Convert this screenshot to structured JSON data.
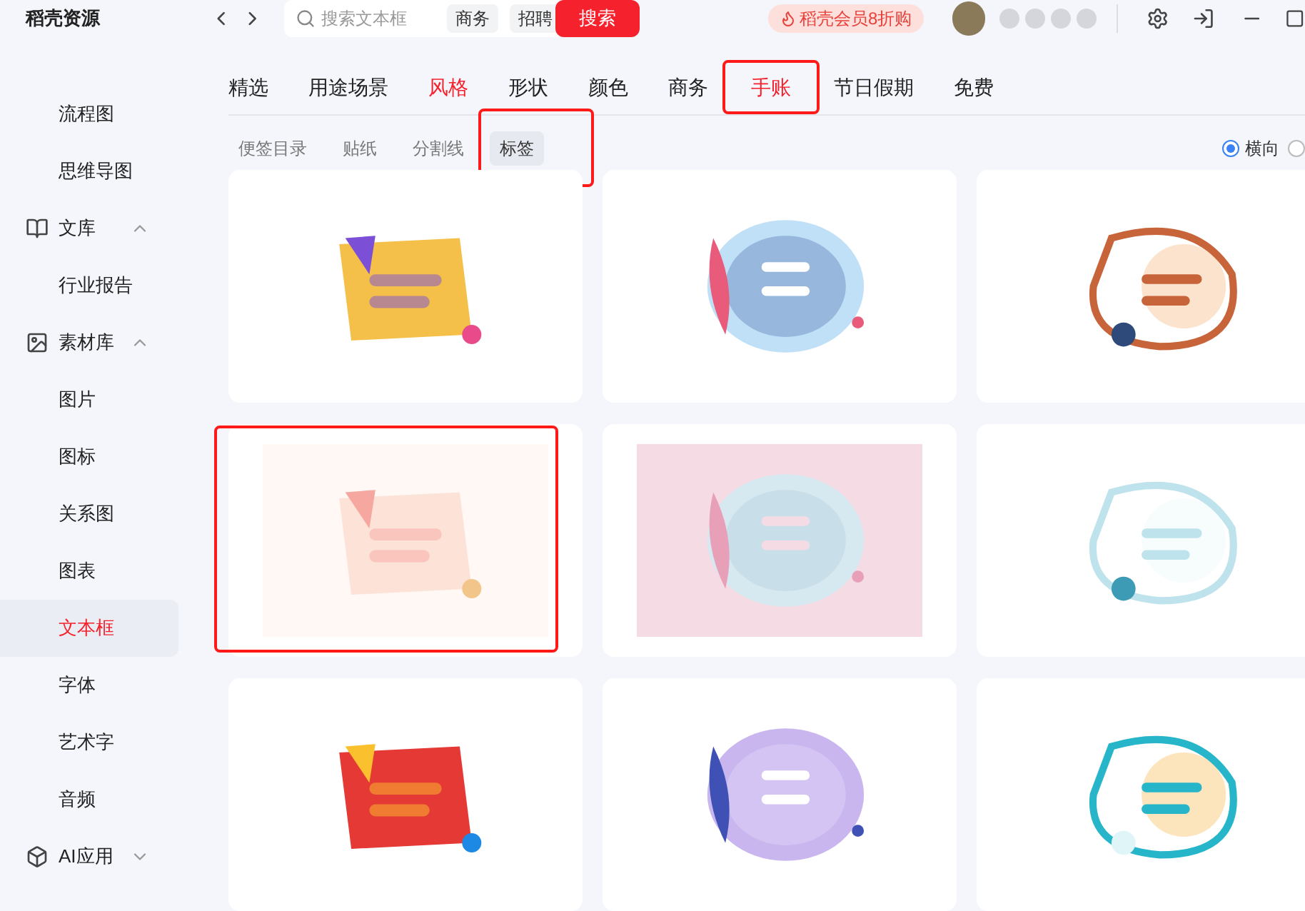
{
  "app": {
    "title": "稻壳资源"
  },
  "search": {
    "placeholder": "搜索文本框",
    "tags": [
      "商务",
      "招聘"
    ],
    "button": "搜索"
  },
  "promo": {
    "label": "稻壳会员8折购"
  },
  "sidebar": {
    "items": [
      {
        "kind": "item",
        "label": "流程图",
        "selected": false
      },
      {
        "kind": "item",
        "label": "思维导图",
        "selected": false
      },
      {
        "kind": "group",
        "label": "文库",
        "expanded": true
      },
      {
        "kind": "item",
        "label": "行业报告",
        "selected": false
      },
      {
        "kind": "group",
        "label": "素材库",
        "expanded": true
      },
      {
        "kind": "item",
        "label": "图片",
        "selected": false
      },
      {
        "kind": "item",
        "label": "图标",
        "selected": false
      },
      {
        "kind": "item",
        "label": "关系图",
        "selected": false
      },
      {
        "kind": "item",
        "label": "图表",
        "selected": false
      },
      {
        "kind": "item",
        "label": "文本框",
        "selected": true
      },
      {
        "kind": "item",
        "label": "字体",
        "selected": false
      },
      {
        "kind": "item",
        "label": "艺术字",
        "selected": false
      },
      {
        "kind": "item",
        "label": "音频",
        "selected": false
      },
      {
        "kind": "group",
        "label": "AI应用",
        "expanded": false
      }
    ]
  },
  "categories": [
    {
      "label": "精选",
      "selected": false,
      "highlighted": false
    },
    {
      "label": "用途场景",
      "selected": false,
      "highlighted": false
    },
    {
      "label": "风格",
      "selected": true,
      "highlighted": false
    },
    {
      "label": "形状",
      "selected": false,
      "highlighted": false
    },
    {
      "label": "颜色",
      "selected": false,
      "highlighted": false
    },
    {
      "label": "商务",
      "selected": false,
      "highlighted": false
    },
    {
      "label": "手账",
      "selected": true,
      "highlighted": true
    },
    {
      "label": "节日假期",
      "selected": false,
      "highlighted": false
    },
    {
      "label": "免费",
      "selected": false,
      "highlighted": false
    }
  ],
  "subcategories": [
    {
      "label": "便签目录",
      "selected": false,
      "highlighted": false
    },
    {
      "label": "贴纸",
      "selected": false,
      "highlighted": false
    },
    {
      "label": "分割线",
      "selected": false,
      "highlighted": false
    },
    {
      "label": "标签",
      "selected": true,
      "highlighted": true
    }
  ],
  "orientation": [
    {
      "label": "横向",
      "selected": true
    },
    {
      "selected": false
    }
  ],
  "cards": [
    {
      "kind": "picture",
      "highlighted": false
    },
    {
      "kind": "picture",
      "highlighted": false
    },
    {
      "kind": "picture",
      "highlighted": false
    },
    {
      "kind": "picture",
      "highlighted": true
    },
    {
      "kind": "picture",
      "highlighted": false
    },
    {
      "kind": "picture",
      "highlighted": false
    },
    {
      "kind": "picture",
      "highlighted": false
    },
    {
      "kind": "picture",
      "highlighted": false
    },
    {
      "kind": "picture",
      "highlighted": false
    }
  ]
}
